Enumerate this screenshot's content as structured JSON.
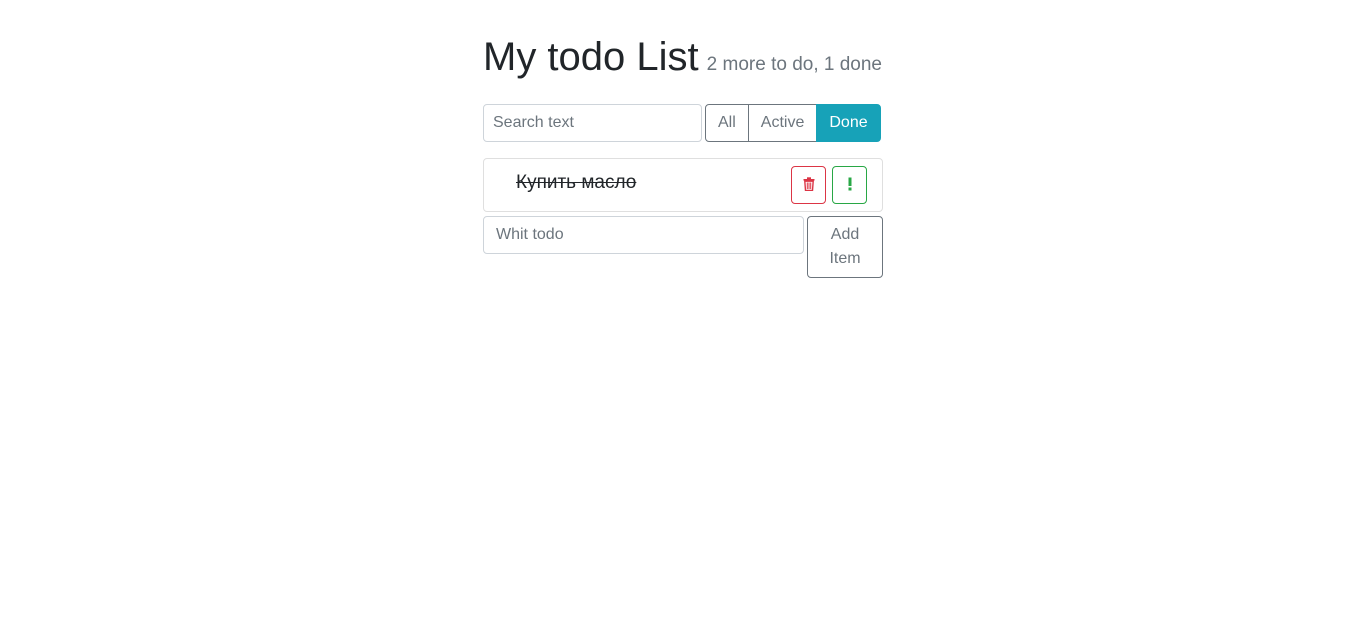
{
  "header": {
    "title": "My todo List",
    "status": "2 more to do, 1 done"
  },
  "search": {
    "placeholder": "Search text",
    "value": ""
  },
  "filters": [
    {
      "label": "All",
      "active": false
    },
    {
      "label": "Active",
      "active": false
    },
    {
      "label": "Done",
      "active": true
    }
  ],
  "todos": [
    {
      "label": "Купить масло",
      "done": true,
      "important": false
    }
  ],
  "add_form": {
    "placeholder": "Whit todo",
    "value": "",
    "button_label": "Add Item"
  },
  "icons": {
    "delete": "trash-icon",
    "important": "exclamation-icon"
  },
  "colors": {
    "accent": "#17a2b8",
    "danger": "#dc3545",
    "success": "#28a745",
    "muted": "#6c757d"
  }
}
